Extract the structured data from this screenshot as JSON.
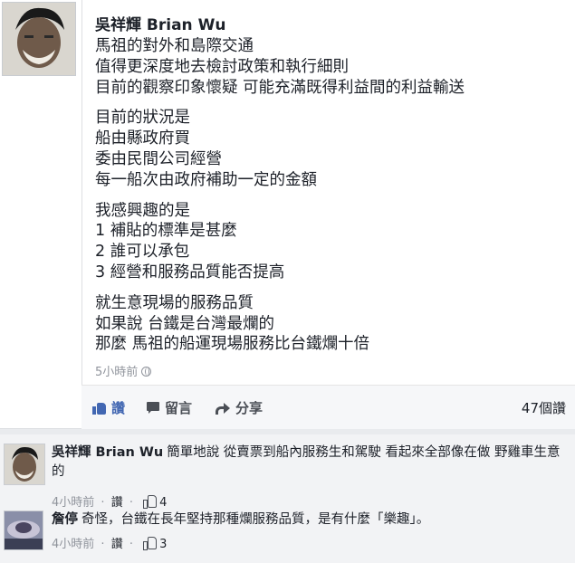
{
  "post": {
    "author": "吳祥輝 Brian Wu",
    "paragraphs": [
      [
        "馬祖的對外和島際交通",
        "值得更深度地去檢討政策和執行細則",
        "目前的觀察印象懷疑 可能充滿既得利益間的利益輸送"
      ],
      [
        "目前的狀況是",
        "船由縣政府買",
        "委由民間公司經營",
        "每一船次由政府補助一定的金額"
      ],
      [
        "我感興趣的是",
        "1 補貼的標準是甚麼",
        "2 誰可以承包",
        "3 經營和服務品質能否提高"
      ],
      [
        "就生意現場的服務品質",
        "如果說 台鐵是台灣最爛的",
        "那麼 馬祖的船運現場服務比台鐵爛十倍"
      ]
    ],
    "timestamp": "5小時前",
    "actions": {
      "like": "讚",
      "comment": "留言",
      "share": "分享"
    },
    "likes_count": "47個讚"
  },
  "comments": [
    {
      "author": "吳祥輝 Brian Wu",
      "text": "簡單地說 從賣票到船內服務生和駕駛 看起來全部像在做 野雞車生意的",
      "time": "4小時前",
      "like": "讚",
      "count": "4"
    },
    {
      "author": "詹停",
      "text": "奇怪，台鐵在長年堅持那種爛服務品質，是有什麼「樂趣」。",
      "time": "4小時前",
      "like": "讚",
      "count": "3"
    }
  ],
  "colors": {
    "link_blue": "#4267b2",
    "meta_gray": "#90949c",
    "text": "#1d2129"
  },
  "icons": {
    "like": "thumbs-up-icon",
    "comment": "comment-bubble-icon",
    "share": "share-arrow-icon",
    "audience": "globe-icon"
  }
}
